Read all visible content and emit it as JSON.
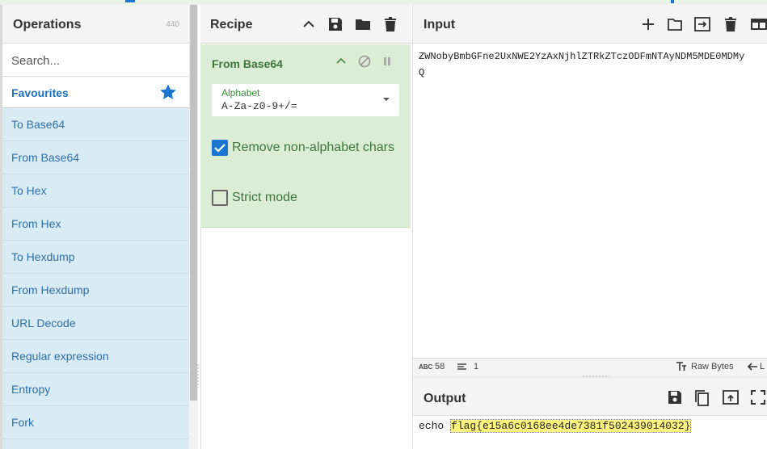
{
  "colors": {
    "accent": "#1b75d1",
    "ops_bg": "#d9ebf5",
    "recipe_op_bg": "#dcedd5",
    "highlight": "#fff680"
  },
  "operations": {
    "title": "Operations",
    "count": "440",
    "search_placeholder": "Search...",
    "favourites_label": "Favourites",
    "items": [
      "To Base64",
      "From Base64",
      "To Hex",
      "From Hex",
      "To Hexdump",
      "From Hexdump",
      "URL Decode",
      "Regular expression",
      "Entropy",
      "Fork"
    ]
  },
  "recipe": {
    "title": "Recipe",
    "operation": {
      "name": "From Base64",
      "alphabet_label": "Alphabet",
      "alphabet_value": "A-Za-z0-9+/=",
      "remove_nonalpha_label": "Remove non-alphabet chars",
      "remove_nonalpha_checked": true,
      "strict_mode_label": "Strict mode",
      "strict_mode_checked": false
    }
  },
  "input": {
    "title": "Input",
    "text": "ZWNobyBmbGFne2UxNWE2YzAxNjhlZTRkZTczODFmNTAyNDM5MDE0MDMy\nQ",
    "length": "58",
    "lines": "1",
    "encoding_label": "Raw Bytes",
    "eol_label": "L"
  },
  "output": {
    "title": "Output",
    "text_prefix": "echo ",
    "highlighted": "flag{e15a6c0168ee4de7381f502439014032}"
  }
}
